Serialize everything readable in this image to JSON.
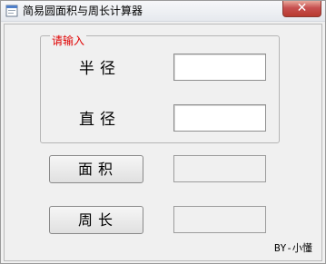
{
  "window": {
    "title": "简易圆面积与周长计算器",
    "close_label": "✕"
  },
  "group": {
    "legend": "请输入"
  },
  "inputs": {
    "radius_label": "半径",
    "radius_value": "",
    "diameter_label": "直径",
    "diameter_value": ""
  },
  "outputs": {
    "area_button": "面积",
    "area_value": "",
    "perimeter_button": "周长",
    "perimeter_value": ""
  },
  "footer": {
    "author": "BY-小懂"
  },
  "icons": {
    "app": "app-icon",
    "close": "close-icon"
  },
  "colors": {
    "legend_text": "#e00000",
    "close_button": "#c75050"
  }
}
